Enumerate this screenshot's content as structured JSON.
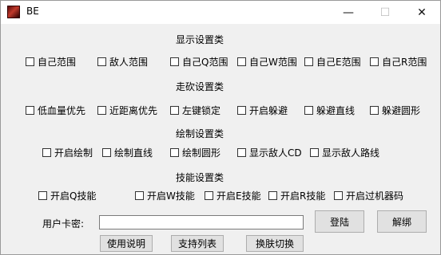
{
  "window": {
    "title": "BE",
    "controls": [
      "—",
      "☐",
      "✕"
    ]
  },
  "sections": {
    "display": "显示设置类",
    "walk": "走砍设置类",
    "draw": "绘制设置类",
    "skill": "技能设置类"
  },
  "display_options": [
    "自己范围",
    "敌人范围",
    "自己Q范围",
    "自己W范围",
    "自己E范围",
    "自己R范围"
  ],
  "walk_options": [
    "低血量优先",
    "近距离优先",
    "左键锁定",
    "开启躲避",
    "躲避直线",
    "躲避圆形"
  ],
  "draw_options": [
    "开启绘制",
    "绘制直线",
    "绘制圆形",
    "显示敌人CD",
    "显示敌人路线"
  ],
  "skill_options": [
    "开启Q技能",
    "开启W技能",
    "开启E技能",
    "开启R技能",
    "开启过机器码"
  ],
  "license": {
    "label": "用户卡密:",
    "value": ""
  },
  "buttons": {
    "login": "登陆",
    "unbind": "解绑",
    "help": "使用说明",
    "support_list": "支持列表",
    "skin_switch": "换肤切换"
  }
}
